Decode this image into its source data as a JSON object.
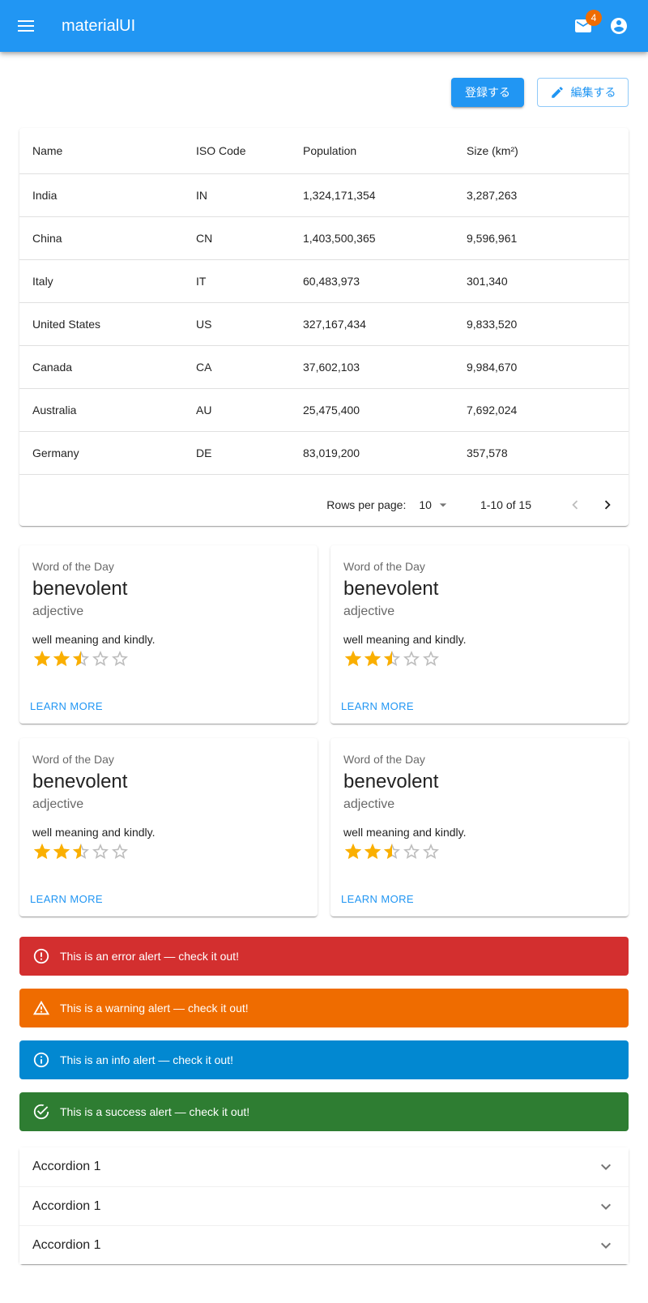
{
  "app": {
    "title": "materialUI",
    "mail_badge": "4"
  },
  "toolbar": {
    "register_label": "登録する",
    "edit_label": "編集する"
  },
  "table": {
    "headers": [
      "Name",
      "ISO Code",
      "Population",
      "Size (km²)"
    ],
    "rows": [
      [
        "India",
        "IN",
        "1,324,171,354",
        "3,287,263"
      ],
      [
        "China",
        "CN",
        "1,403,500,365",
        "9,596,961"
      ],
      [
        "Italy",
        "IT",
        "60,483,973",
        "301,340"
      ],
      [
        "United States",
        "US",
        "327,167,434",
        "9,833,520"
      ],
      [
        "Canada",
        "CA",
        "37,602,103",
        "9,984,670"
      ],
      [
        "Australia",
        "AU",
        "25,475,400",
        "7,692,024"
      ],
      [
        "Germany",
        "DE",
        "83,019,200",
        "357,578"
      ]
    ],
    "pagination": {
      "rows_label": "Rows per page:",
      "rows_value": "10",
      "range": "1-10 of 15"
    }
  },
  "cards": [
    {
      "overline": "Word of the Day",
      "word": "benevolent",
      "pos": "adjective",
      "desc": "well meaning and kindly.",
      "rating": 2.5,
      "action": "LEARN MORE"
    },
    {
      "overline": "Word of the Day",
      "word": "benevolent",
      "pos": "adjective",
      "desc": "well meaning and kindly.",
      "rating": 2.5,
      "action": "LEARN MORE"
    },
    {
      "overline": "Word of the Day",
      "word": "benevolent",
      "pos": "adjective",
      "desc": "well meaning and kindly.",
      "rating": 2.5,
      "action": "LEARN MORE"
    },
    {
      "overline": "Word of the Day",
      "word": "benevolent",
      "pos": "adjective",
      "desc": "well meaning and kindly.",
      "rating": 2.5,
      "action": "LEARN MORE"
    }
  ],
  "alerts": {
    "error": {
      "text": "This is an error alert — check it out!",
      "color": "#d32f2f"
    },
    "warning": {
      "text": "This is a warning alert — check it out!",
      "color": "#ef6c00"
    },
    "info": {
      "text": "This is an info alert — check it out!",
      "color": "#0288d1"
    },
    "success": {
      "text": "This is a success alert — check it out!",
      "color": "#2e7d32"
    }
  },
  "accordions": [
    "Accordion 1",
    "Accordion 1",
    "Accordion 1"
  ],
  "colors": {
    "primary": "#2196f3",
    "star": "#faaf00"
  }
}
